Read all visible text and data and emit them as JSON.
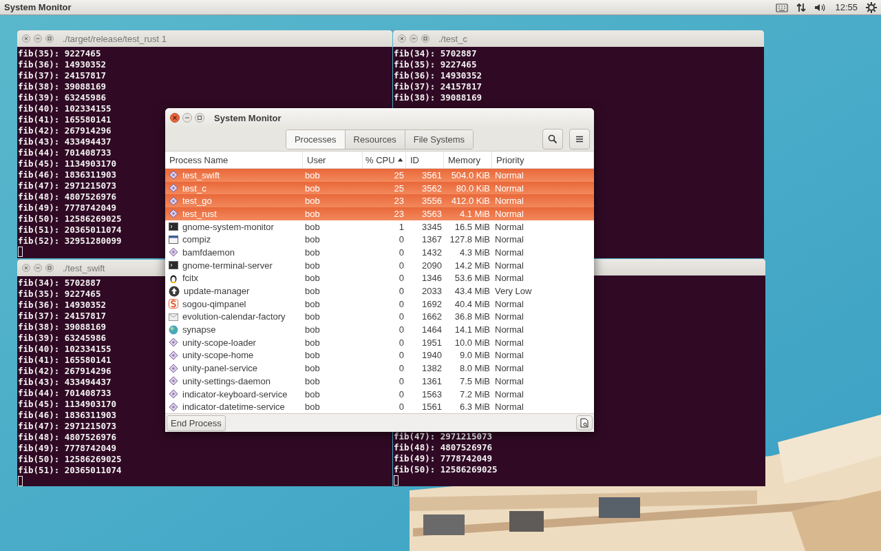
{
  "top_panel": {
    "app_title": "System Monitor",
    "clock": "12:55"
  },
  "terminals": [
    {
      "title": "./target/release/test_rust 1",
      "cursor": true,
      "lines": [
        "fib(35): 9227465",
        "fib(36): 14930352",
        "fib(37): 24157817",
        "fib(38): 39088169",
        "fib(39): 63245986",
        "fib(40): 102334155",
        "fib(41): 165580141",
        "fib(42): 267914296",
        "fib(43): 433494437",
        "fib(44): 701408733",
        "fib(45): 1134903170",
        "fib(46): 1836311903",
        "fib(47): 2971215073",
        "fib(48): 4807526976",
        "fib(49): 7778742049",
        "fib(50): 12586269025",
        "fib(51): 20365011074",
        "fib(52): 32951280099"
      ]
    },
    {
      "title": "./test_c",
      "cursor": false,
      "lines": [
        "fib(34): 5702887",
        "fib(35): 9227465",
        "fib(36): 14930352",
        "fib(37): 24157817",
        "fib(38): 39088169"
      ]
    },
    {
      "title": "./test_swift",
      "cursor": true,
      "lines": [
        "fib(34): 5702887",
        "fib(35): 9227465",
        "fib(36): 14930352",
        "fib(37): 24157817",
        "fib(38): 39088169",
        "fib(39): 63245986",
        "fib(40): 102334155",
        "fib(41): 165580141",
        "fib(42): 267914296",
        "fib(43): 433494437",
        "fib(44): 701408733",
        "fib(45): 1134903170",
        "fib(46): 1836311903",
        "fib(47): 2971215073",
        "fib(48): 4807526976",
        "fib(49): 7778742049",
        "fib(50): 12586269025",
        "fib(51): 20365011074"
      ]
    },
    {
      "cursor": true,
      "lines": [
        "fib(47): 2971215073",
        "fib(48): 4807526976",
        "fib(49): 7778742049",
        "fib(50): 12586269025"
      ]
    }
  ],
  "system_monitor": {
    "title": "System Monitor",
    "tabs": [
      {
        "label": "Processes",
        "selected": true
      },
      {
        "label": "Resources",
        "selected": false
      },
      {
        "label": "File Systems",
        "selected": false
      }
    ],
    "columns": [
      {
        "label": "Process Name",
        "sorted": false
      },
      {
        "label": "User",
        "sorted": false
      },
      {
        "label": "% CPU",
        "sorted": true
      },
      {
        "label": "ID",
        "sorted": false
      },
      {
        "label": "Memory",
        "sorted": false
      },
      {
        "label": "Priority",
        "sorted": false
      }
    ],
    "rows": [
      {
        "kind": "diamond",
        "name": "test_swift",
        "user": "bob",
        "cpu": "25",
        "id": "3561",
        "memory": "504.0 KiB",
        "priority": "Normal",
        "selected": true
      },
      {
        "kind": "diamond",
        "name": "test_c",
        "user": "bob",
        "cpu": "25",
        "id": "3562",
        "memory": "80.0 KiB",
        "priority": "Normal",
        "selected": true
      },
      {
        "kind": "diamond",
        "name": "test_go",
        "user": "bob",
        "cpu": "23",
        "id": "3556",
        "memory": "412.0 KiB",
        "priority": "Normal",
        "selected": true
      },
      {
        "kind": "diamond",
        "name": "test_rust",
        "user": "bob",
        "cpu": "23",
        "id": "3563",
        "memory": "4.1 MiB",
        "priority": "Normal",
        "selected": true
      },
      {
        "kind": "terminal",
        "name": "gnome-system-monitor",
        "user": "bob",
        "cpu": "1",
        "id": "3345",
        "memory": "16.5 MiB",
        "priority": "Normal",
        "selected": false
      },
      {
        "kind": "window",
        "name": "compiz",
        "user": "bob",
        "cpu": "0",
        "id": "1367",
        "memory": "127.8 MiB",
        "priority": "Normal",
        "selected": false
      },
      {
        "kind": "diamond",
        "name": "bamfdaemon",
        "user": "bob",
        "cpu": "0",
        "id": "1432",
        "memory": "4.3 MiB",
        "priority": "Normal",
        "selected": false
      },
      {
        "kind": "terminal",
        "name": "gnome-terminal-server",
        "user": "bob",
        "cpu": "0",
        "id": "2090",
        "memory": "14.2 MiB",
        "priority": "Normal",
        "selected": false
      },
      {
        "kind": "penguin",
        "name": "fcitx",
        "user": "bob",
        "cpu": "0",
        "id": "1346",
        "memory": "53.6 MiB",
        "priority": "Normal",
        "selected": false
      },
      {
        "kind": "update",
        "name": "update-manager",
        "user": "bob",
        "cpu": "0",
        "id": "2033",
        "memory": "43.4 MiB",
        "priority": "Very Low",
        "selected": false
      },
      {
        "kind": "sogou",
        "name": "sogou-qimpanel",
        "user": "bob",
        "cpu": "0",
        "id": "1692",
        "memory": "40.4 MiB",
        "priority": "Normal",
        "selected": false
      },
      {
        "kind": "calendar",
        "name": "evolution-calendar-factory",
        "user": "bob",
        "cpu": "0",
        "id": "1662",
        "memory": "36.8 MiB",
        "priority": "Normal",
        "selected": false
      },
      {
        "kind": "synapse",
        "name": "synapse",
        "user": "bob",
        "cpu": "0",
        "id": "1464",
        "memory": "14.1 MiB",
        "priority": "Normal",
        "selected": false
      },
      {
        "kind": "diamond",
        "name": "unity-scope-loader",
        "user": "bob",
        "cpu": "0",
        "id": "1951",
        "memory": "10.0 MiB",
        "priority": "Normal",
        "selected": false
      },
      {
        "kind": "diamond",
        "name": "unity-scope-home",
        "user": "bob",
        "cpu": "0",
        "id": "1940",
        "memory": "9.0 MiB",
        "priority": "Normal",
        "selected": false
      },
      {
        "kind": "diamond",
        "name": "unity-panel-service",
        "user": "bob",
        "cpu": "0",
        "id": "1382",
        "memory": "8.0 MiB",
        "priority": "Normal",
        "selected": false
      },
      {
        "kind": "diamond",
        "name": "unity-settings-daemon",
        "user": "bob",
        "cpu": "0",
        "id": "1361",
        "memory": "7.5 MiB",
        "priority": "Normal",
        "selected": false
      },
      {
        "kind": "diamond",
        "name": "indicator-keyboard-service",
        "user": "bob",
        "cpu": "0",
        "id": "1563",
        "memory": "7.2 MiB",
        "priority": "Normal",
        "selected": false
      },
      {
        "kind": "diamond",
        "name": "indicator-datetime-service",
        "user": "bob",
        "cpu": "0",
        "id": "1561",
        "memory": "6.3 MiB",
        "priority": "Normal",
        "selected": false
      }
    ],
    "end_button": "End Process"
  }
}
